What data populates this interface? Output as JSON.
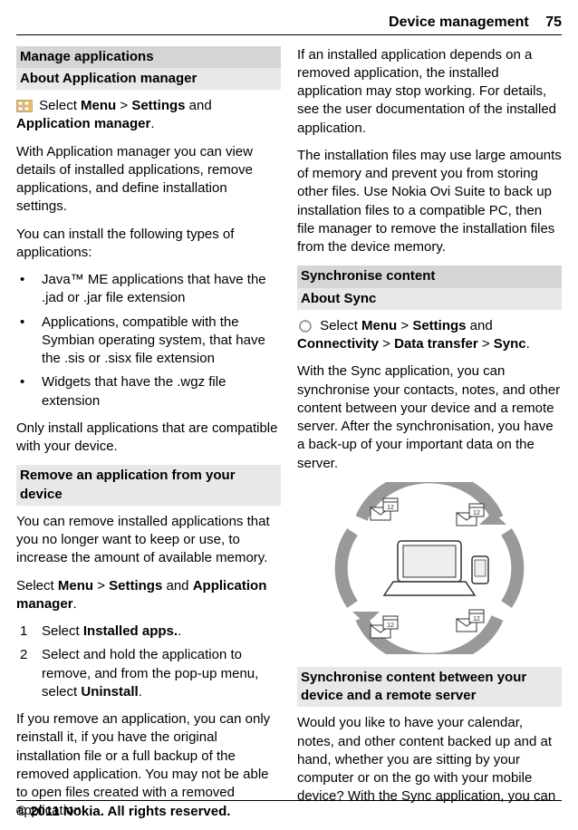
{
  "header": {
    "title": "Device management",
    "page": "75"
  },
  "left": {
    "sec1": "Manage applications",
    "sub1": "About Application manager",
    "p1a": " Select ",
    "p1b": "Menu",
    "p1c": " > ",
    "p1d": "Settings",
    "p1e": " and ",
    "p1f": "Application manager",
    "p1g": ".",
    "p2": "With Application manager you can view details of installed applications, remove applications, and define installation settings.",
    "p3": "You can install the following types of applications:",
    "li1": "Java™ ME applications that have the .jad or .jar file extension",
    "li2": "Applications, compatible with the Symbian operating system, that have the .sis or .sisx file extension",
    "li3": "Widgets that have the .wgz file extension",
    "p4": "Only install applications that are compatible with your device.",
    "sub2": "Remove an application from your device",
    "p5": "You can remove installed applications that you no longer want to keep or use, to increase the amount of available memory.",
    "p6a": "Select ",
    "p6b": "Menu",
    "p6c": " > ",
    "p6d": "Settings",
    "p6e": " and ",
    "p6f": "Application manager",
    "p6g": ".",
    "ol1n": "1",
    "ol1a": "Select ",
    "ol1b": "Installed apps.",
    "ol1c": ".",
    "ol2n": "2",
    "ol2a": "Select and hold the application to remove, and from the pop-up menu, select ",
    "ol2b": "Uninstall",
    "ol2c": ".",
    "p7": "If you remove an application, you can only reinstall it, if you have the original installation file or a full backup of the removed application. You may not be able to open files created with a removed application."
  },
  "right": {
    "p1": "If an installed application depends on a removed application, the installed application may stop working. For details, see the user documentation of the installed application.",
    "p2": "The installation files may use large amounts of memory and prevent you from storing other files. Use Nokia Ovi Suite to back up installation files to a compatible PC, then file manager to remove the installation files from the device memory.",
    "sec1": "Synchronise content",
    "sub1": "About Sync",
    "p3a": " Select ",
    "p3b": "Menu",
    "p3c": " > ",
    "p3d": "Settings",
    "p3e": " and ",
    "p3f": "Connectivity",
    "p3g": " > ",
    "p3h": "Data transfer",
    "p3i": " > ",
    "p3j": "Sync",
    "p3k": ".",
    "p4": "With the Sync application, you can synchronise your contacts, notes, and other content between your device and a remote server. After the synchronisation, you have a back-up of your important data on the server.",
    "sub2": "Synchronise content between your device and a remote server",
    "p5": "Would you like to have your calendar, notes, and other content backed up and at hand, whether you are sitting by your computer or on the go with your mobile device? With the Sync application, you can"
  },
  "footer": "© 2011 Nokia. All rights reserved."
}
